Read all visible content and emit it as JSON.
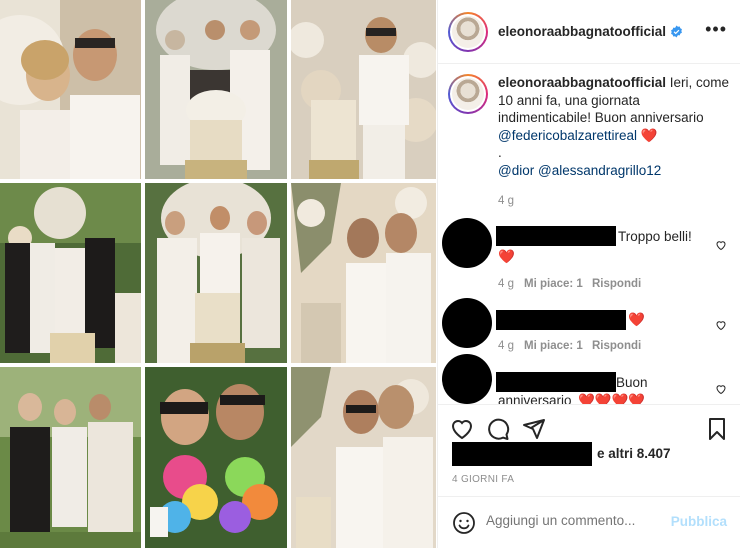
{
  "post": {
    "username": "eleonoraabbagnatoofficial",
    "verified_icon": "verified-badge-icon",
    "more_icon": "more-dots-icon",
    "more_label": "•••"
  },
  "caption": {
    "username": "eleonoraabbagnatoofficial",
    "text_1": "Ieri, come 10 anni fa, una giornata indimenticabile! Buon anniversario",
    "mention_1": "@federicobalzarettireal",
    "heart": "❤️",
    "dot": ".",
    "mention_2": "@dior",
    "mention_3": "@alessandragrillo12",
    "age": "4 g"
  },
  "comments": [
    {
      "text": "Troppo belli!",
      "emoji": "❤️",
      "age": "4 g",
      "likes": "Mi piace: 1",
      "reply": "Rispondi"
    },
    {
      "text": "",
      "emoji": "❤️",
      "age": "4 g",
      "likes": "Mi piace: 1",
      "reply": "Rispondi"
    },
    {
      "text": "Buon",
      "text_2": "anniversario",
      "emoji": "❤️❤️❤️❤️",
      "age": "",
      "likes": "",
      "reply": ""
    }
  ],
  "likes": {
    "text": "e altri 8.407"
  },
  "post_time": "4 GIORNI FA",
  "composer": {
    "placeholder": "Aggiungi un commento...",
    "publish_label": "Pubblica"
  },
  "colors": {
    "link": "#00376b",
    "publish_disabled": "#b2dffc",
    "meta_gray": "#8e8e8e",
    "heart_red": "#ed4956"
  }
}
